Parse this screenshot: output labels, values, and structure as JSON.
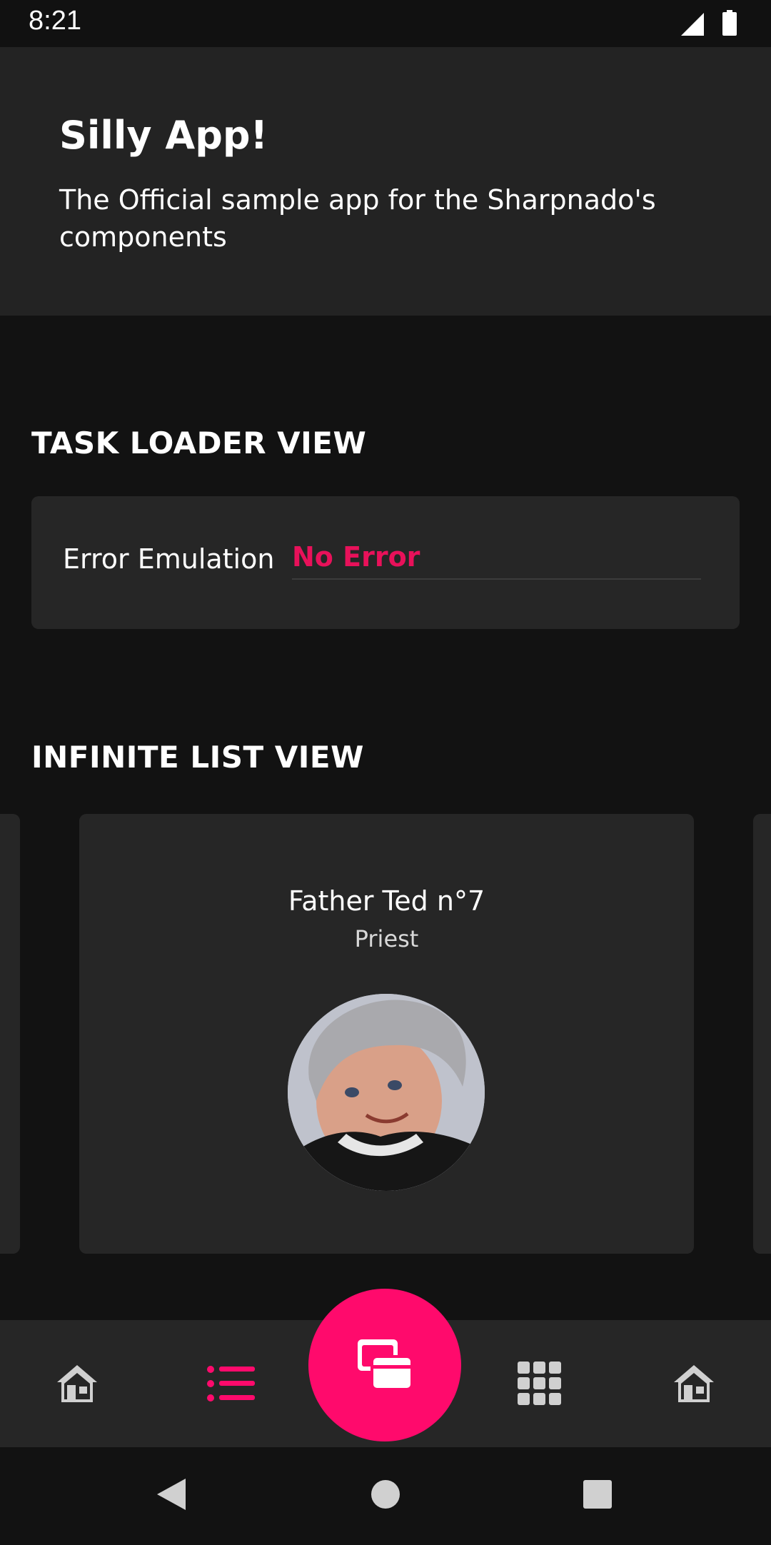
{
  "status_bar": {
    "time": "8:21"
  },
  "header": {
    "title": "Silly App!",
    "subtitle": "The Official sample app for the Sharpnado's components"
  },
  "task_loader": {
    "section_title": "TASK LOADER VIEW",
    "error_label": "Error Emulation",
    "error_value": "No Error"
  },
  "infinite_list": {
    "section_title": "INFINITE LIST VIEW",
    "card": {
      "name": "Father Ted n°7",
      "role": "Priest"
    }
  },
  "tabs": [
    {
      "icon": "home-icon",
      "selected": false
    },
    {
      "icon": "list-icon",
      "selected": true
    },
    {
      "icon": "cards-icon",
      "selected": false
    },
    {
      "icon": "grid-icon",
      "selected": false
    },
    {
      "icon": "home-icon",
      "selected": false
    }
  ],
  "colors": {
    "accent": "#ff0a6c",
    "error_value": "#e8115a",
    "background": "#121212",
    "surface": "#262626",
    "header": "#232323"
  }
}
